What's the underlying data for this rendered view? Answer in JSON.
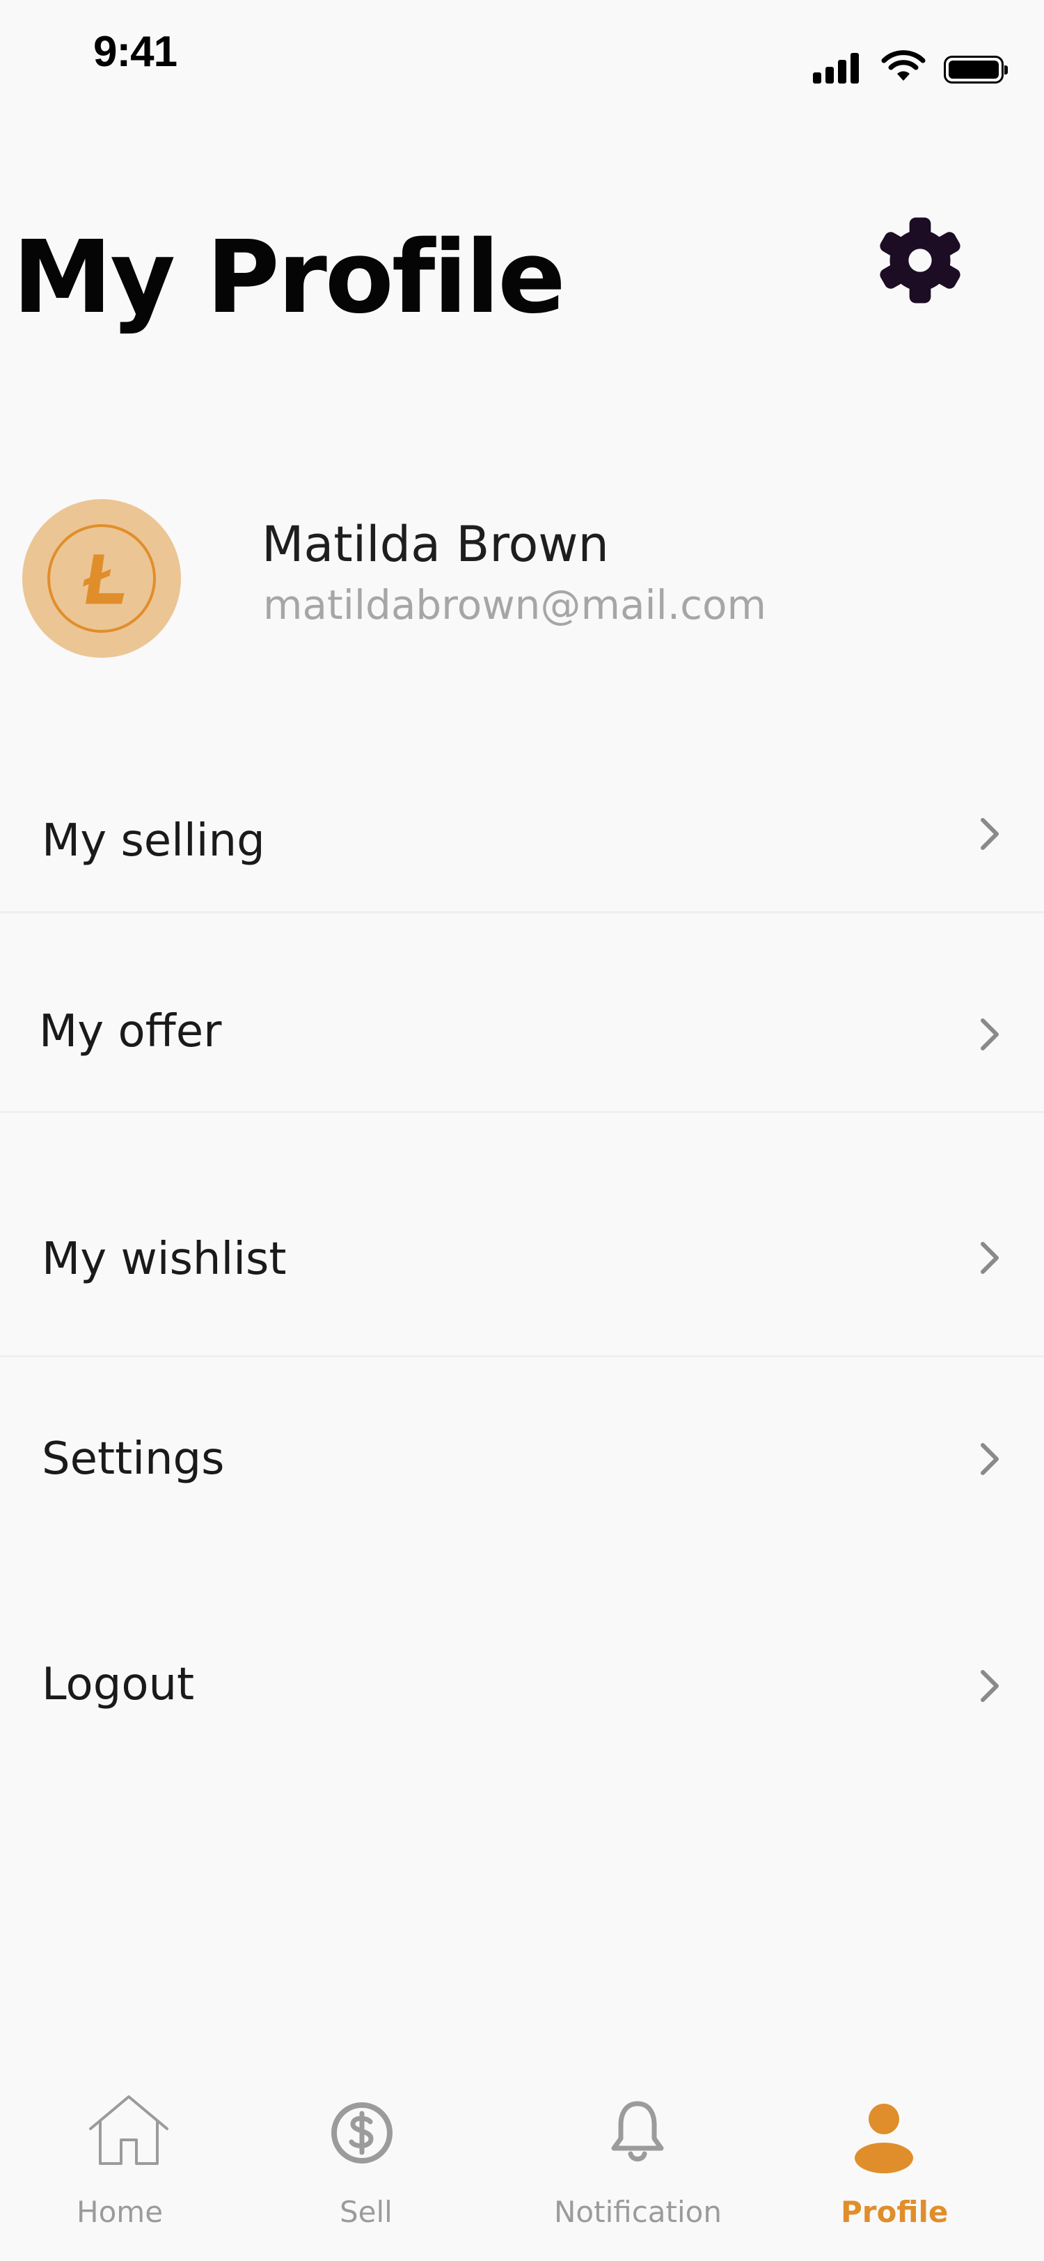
{
  "status_bar": {
    "time": "9:41"
  },
  "header": {
    "title": "My Profile",
    "settings_icon": "gear-icon"
  },
  "profile": {
    "name": "Matilda Brown",
    "email": "matildabrown@mail.com",
    "avatar_icon": "litecoin-icon"
  },
  "menu": {
    "items": [
      {
        "label": "My selling"
      },
      {
        "label": "My offer"
      },
      {
        "label": "My wishlist"
      },
      {
        "label": "Settings"
      },
      {
        "label": "Logout"
      }
    ]
  },
  "bottom_nav": {
    "items": [
      {
        "label": "Home",
        "icon": "home-icon",
        "active": false
      },
      {
        "label": "Sell",
        "icon": "dollar-icon",
        "active": false
      },
      {
        "label": "Notification",
        "icon": "bell-icon",
        "active": false
      },
      {
        "label": "Profile",
        "icon": "person-icon",
        "active": true
      }
    ]
  },
  "colors": {
    "accent": "#e08e2b",
    "avatar_bg": "#ecc594",
    "settings_icon": "#1c0c24",
    "inactive": "#9b9b9b",
    "background": "#f9f9f9"
  }
}
